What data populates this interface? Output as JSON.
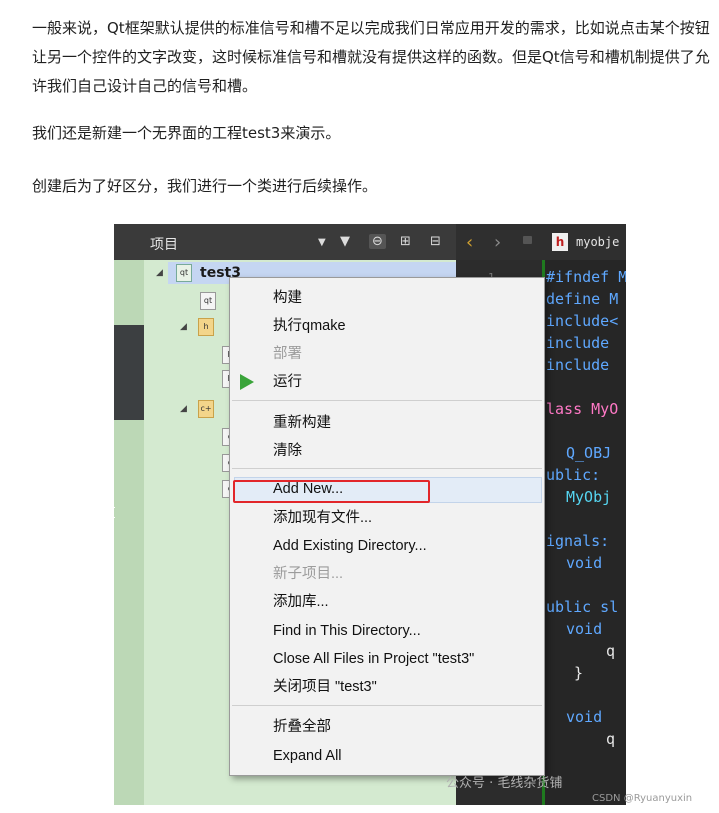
{
  "article": {
    "para1": "一般来说，Qt框架默认提供的标准信号和槽不足以完成我们日常应用开发的需求，比如说点击某个按钮让另一个控件的文字改变，这时候标准信号和槽就没有提供这样的函数。但是Qt信号和槽机制提供了允许我们自己设计自己的信号和槽。",
    "para2": "我们还是新建一个无界面的工程test3来演示。",
    "para3": "创建后为了好区分，我们进行一个类进行后续操作。"
  },
  "project_panel": {
    "title": "项目",
    "project_name": "test3"
  },
  "editor": {
    "file_name": "myobje",
    "line_number": "1",
    "code_lines": [
      "#ifndef M",
      "define M",
      "include<",
      "include",
      "include",
      "lass MyO",
      "Q_OBJ",
      "ublic:",
      "MyObj",
      "ignals:",
      "void",
      "ublic sl",
      "void",
      "q",
      "}",
      "void",
      "q"
    ]
  },
  "context_menu": {
    "items": [
      {
        "label": "构建"
      },
      {
        "label": "执行qmake"
      },
      {
        "label": "部署"
      },
      {
        "label": "运行"
      },
      {
        "label": "重新构建"
      },
      {
        "label": "清除"
      },
      {
        "label": "Add New..."
      },
      {
        "label": "添加现有文件..."
      },
      {
        "label": "Add Existing Directory..."
      },
      {
        "label": "新子项目..."
      },
      {
        "label": "添加库..."
      },
      {
        "label": "Find in This Directory..."
      },
      {
        "label": "Close All Files in Project \"test3\""
      },
      {
        "label": "关闭项目 \"test3\""
      },
      {
        "label": "折叠全部"
      },
      {
        "label": "Expand All"
      }
    ]
  },
  "watermark": {
    "wechat": "公众号 · 毛线杂货铺",
    "csdn": "CSDN @Ryuanyuxin"
  },
  "colors": {
    "highlight_box": "#e2262a",
    "run_icon": "#3aa43a"
  }
}
